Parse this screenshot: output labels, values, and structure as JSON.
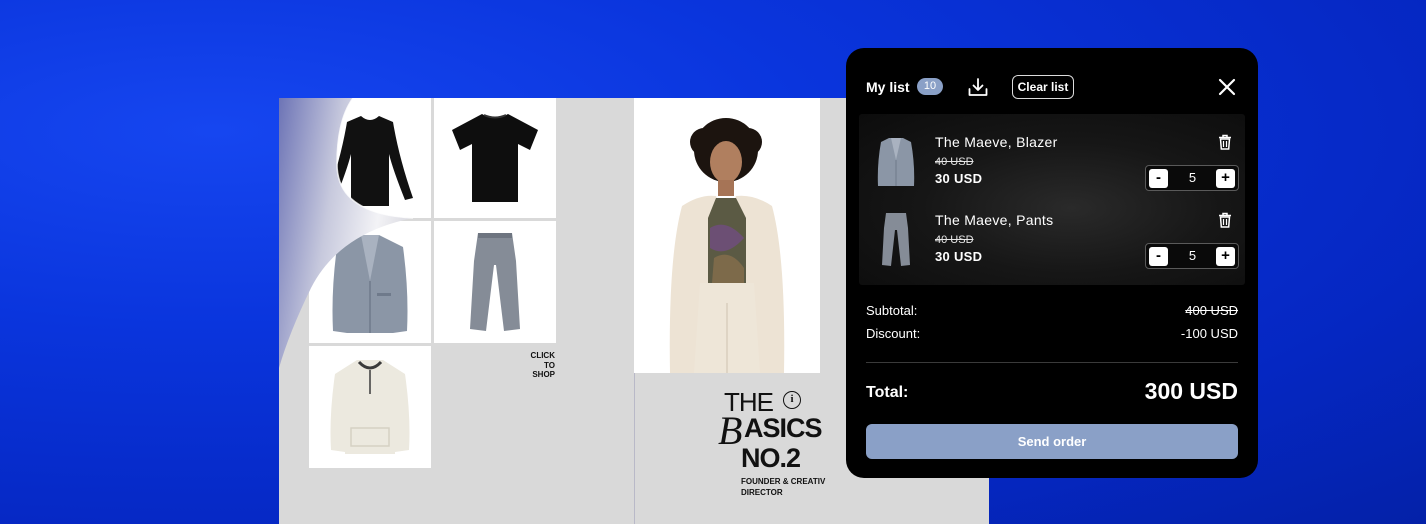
{
  "catalog": {
    "click_to_shop": [
      "CLICK",
      "TO",
      "SHOP"
    ],
    "brand": {
      "the": "THE",
      "info": "i",
      "script_b": "B",
      "basics": "ASICS",
      "number": "NO.2",
      "founder": "FOUNDER & CREATIV DIRECTOR"
    }
  },
  "panel": {
    "title": "My list",
    "count": "10",
    "clear_label": "Clear list",
    "items": [
      {
        "name": "The Maeve, Blazer",
        "old_price": "40 USD",
        "new_price": "30 USD",
        "qty": "5",
        "minus": "-",
        "plus": "+"
      },
      {
        "name": "The Maeve, Pants",
        "old_price": "40 USD",
        "new_price": "30 USD",
        "qty": "5",
        "minus": "-",
        "plus": "+"
      }
    ],
    "subtotal_label": "Subtotal:",
    "subtotal_value": "400 USD",
    "discount_label": "Discount:",
    "discount_value": "-100 USD",
    "total_label": "Total:",
    "total_value": "300 USD",
    "send_label": "Send order",
    "accent_color": "#8aa0c7"
  },
  "icons": [
    "download-icon",
    "close-icon",
    "trash-icon"
  ]
}
